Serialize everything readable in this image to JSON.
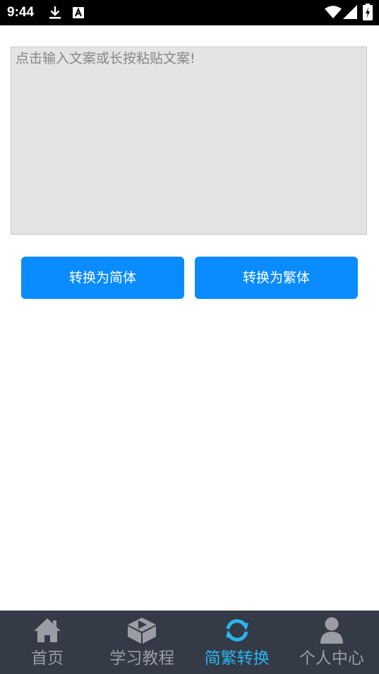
{
  "status_bar": {
    "time": "9:44",
    "icons": [
      "download-icon",
      "accessibility-a-icon",
      "wifi-icon",
      "signal-icon",
      "battery-charging-icon"
    ]
  },
  "editor": {
    "placeholder": "点击输入文案或长按粘贴文案!",
    "value": ""
  },
  "actions": {
    "to_simplified": "转换为简体",
    "to_traditional": "转换为繁体"
  },
  "tabs": [
    {
      "label": "首页",
      "icon": "home-icon",
      "active": false
    },
    {
      "label": "学习教程",
      "icon": "tutorial-box-icon",
      "active": false
    },
    {
      "label": "简繁转换",
      "icon": "refresh-icon",
      "active": true
    },
    {
      "label": "个人中心",
      "icon": "user-icon",
      "active": false
    }
  ],
  "colors": {
    "accent": "#0a8cff",
    "tab_active": "#2ab4ee",
    "tab_inactive": "#9a9da3",
    "tab_bar_bg": "#343a46",
    "input_bg": "#e4e4e4"
  }
}
